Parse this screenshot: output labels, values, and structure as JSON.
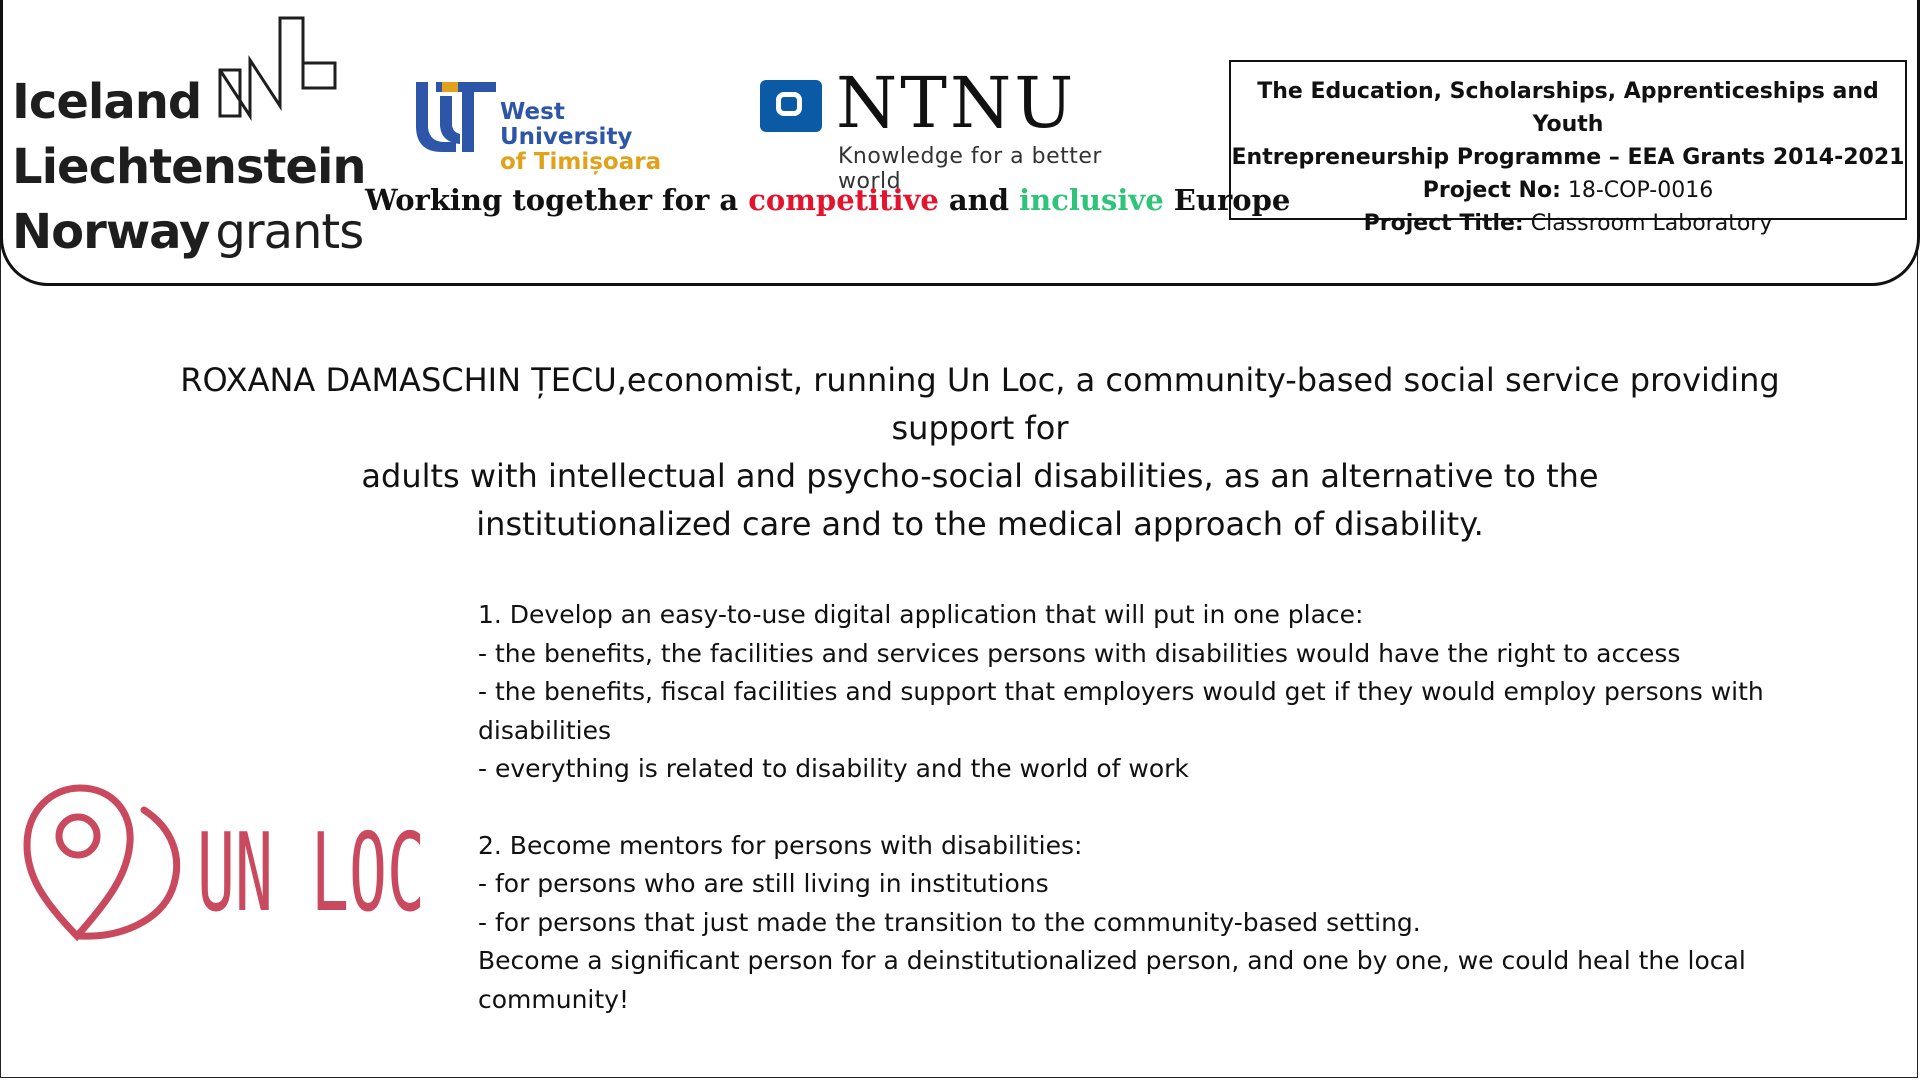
{
  "header": {
    "grants_logo": {
      "line1": "Iceland",
      "line2": "Liechtenstein",
      "line3": "Norway",
      "line3_suffix": "grants"
    },
    "university_logo": {
      "name_line1": "West University",
      "name_line2": "of Timișoara",
      "colors": {
        "blue": "#2d56a8",
        "gold": "#e0a21a"
      }
    },
    "ntnu_logo": {
      "name": "NTNU",
      "tagline": "Knowledge for a better world",
      "color": "#0b5aa6"
    },
    "tagline": {
      "part1": "Working together for a ",
      "competitive": "competitive",
      "part2": " and ",
      "inclusive": "inclusive",
      "part3": " Europe",
      "colors": {
        "competitive": "#e3142c",
        "inclusive": "#2ec47a"
      }
    },
    "project_box": {
      "line1": "The Education, Scholarships, Apprenticeships and Youth",
      "line2": "Entrepreneurship Programme – EEA Grants 2014-2021",
      "project_no_label": "Project No:",
      "project_no_value": " 18-COP-0016",
      "project_title_label": "Project Title:",
      "project_title_value": " Classroom Laboratory"
    }
  },
  "main": {
    "intro_line1": "ROXANA DAMASCHIN ȚECU,economist, running Un Loc, a community-based social service providing",
    "intro_line2": "support for",
    "intro_line3": "adults with intellectual and psycho-social disabilities, as an alternative to the",
    "intro_line4": "institutionalized care and to the medical approach of disability.",
    "list": {
      "item1_title": "1. Develop an easy-to-use digital application that will put in one place:",
      "item1_b1": "- the benefits, the facilities and services persons with disabilities would have the right to access",
      "item1_b2": "- the benefits, fiscal facilities and support that employers would get if they would employ persons with disabilities",
      "item1_b3": "- everything is related to disability and the world of work",
      "item2_title": "2. Become mentors for persons with disabilities:",
      "item2_b1": "- for persons who are still living in institutions",
      "item2_b2": "- for persons that just made the transition to the community-based setting.",
      "closing": "Become a significant person for a deinstitutionalized person, and one by one, we could heal the local community!"
    }
  },
  "unloc_logo": {
    "text": "UN LOC",
    "color": "#c94a5e",
    "icon": "location-pin-icon"
  }
}
